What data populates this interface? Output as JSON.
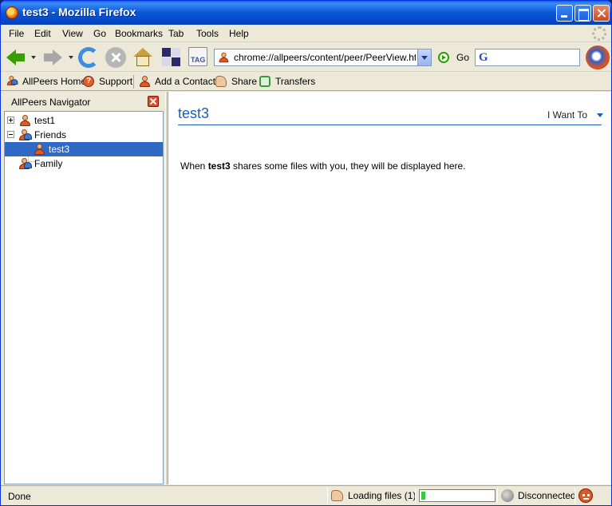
{
  "window": {
    "title": "test3 - Mozilla Firefox"
  },
  "menubar": {
    "items": [
      "File",
      "Edit",
      "View",
      "Go",
      "Bookmarks",
      "Tab",
      "Tools",
      "Help"
    ]
  },
  "navbar": {
    "url": "chrome://allpeers/content/peer/PeerView.html?",
    "go_label": "Go",
    "search_value": ""
  },
  "bookmarks": {
    "items": [
      "AllPeers Home",
      "Support",
      "Add a Contact",
      "Share",
      "Transfers"
    ]
  },
  "sidebar": {
    "title": "AllPeers Navigator",
    "tree": [
      {
        "label": "test1",
        "expanded": false,
        "selected": false
      },
      {
        "label": "Friends",
        "expanded": true,
        "selected": false
      },
      {
        "label": "test3",
        "expanded": false,
        "selected": true
      },
      {
        "label": "Family",
        "expanded": false,
        "selected": false
      }
    ]
  },
  "content": {
    "peer_name": "test3",
    "menu_label": "I Want To",
    "message_before": "When ",
    "message_name": "test3",
    "message_after": " shares some files with you, they will be displayed here."
  },
  "statusbar": {
    "status": "Done",
    "loading": "Loading files (1)",
    "progress_fraction": 0.05,
    "connection": "Disconnected"
  },
  "colors": {
    "accent": "#1a5fb4",
    "selection": "#316ac5",
    "titlebar": "#0a56d6"
  }
}
